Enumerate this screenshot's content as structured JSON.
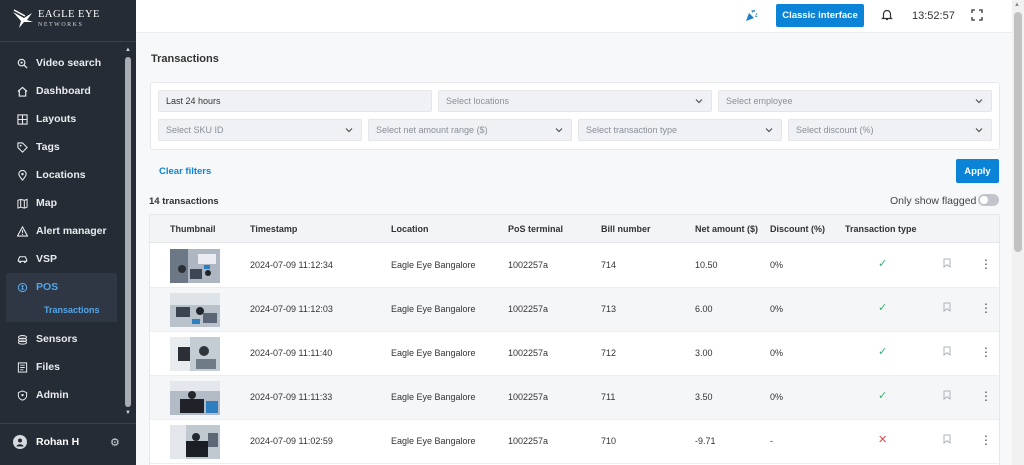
{
  "brand": {
    "name_line1": "EAGLE EYE",
    "name_line2": "NETWORKS"
  },
  "sidebar": {
    "items": [
      {
        "label": "Video search",
        "icon": "video-search-icon"
      },
      {
        "label": "Dashboard",
        "icon": "home-icon"
      },
      {
        "label": "Layouts",
        "icon": "layouts-icon"
      },
      {
        "label": "Tags",
        "icon": "tag-icon"
      },
      {
        "label": "Locations",
        "icon": "location-pin-icon"
      },
      {
        "label": "Map",
        "icon": "map-icon"
      },
      {
        "label": "Alert manager",
        "icon": "alert-icon"
      },
      {
        "label": "VSP",
        "icon": "car-icon"
      },
      {
        "label": "POS",
        "icon": "pos-icon"
      },
      {
        "label": "Sensors",
        "icon": "sensors-icon"
      },
      {
        "label": "Files",
        "icon": "files-icon"
      },
      {
        "label": "Admin",
        "icon": "admin-icon"
      }
    ],
    "active_sub": "Transactions",
    "user": "Rohan H"
  },
  "topbar": {
    "classic_button": "Classic interface",
    "time": "13:52:57"
  },
  "page": {
    "title": "Transactions",
    "filters": {
      "time_range": "Last 24 hours",
      "locations": "Select locations",
      "employee": "Select employee",
      "sku": "Select SKU ID",
      "net_amount": "Select net amount range ($)",
      "transaction_type": "Select transaction type",
      "discount": "Select discount (%)"
    },
    "clear_filters": "Clear filters",
    "apply": "Apply",
    "count": "14 transactions",
    "only_flagged": "Only show flagged"
  },
  "table": {
    "columns": [
      "Thumbnail",
      "Timestamp",
      "Location",
      "PoS terminal",
      "Bill number",
      "Net amount ($)",
      "Discount (%)",
      "Transaction type"
    ],
    "rows": [
      {
        "timestamp": "2024-07-09 11:12:34",
        "location": "Eagle Eye Bangalore",
        "terminal": "1002257a",
        "bill": "714",
        "amount": "10.50",
        "discount": "0%",
        "status": "success"
      },
      {
        "timestamp": "2024-07-09 11:12:03",
        "location": "Eagle Eye Bangalore",
        "terminal": "1002257a",
        "bill": "713",
        "amount": "6.00",
        "discount": "0%",
        "status": "success"
      },
      {
        "timestamp": "2024-07-09 11:11:40",
        "location": "Eagle Eye Bangalore",
        "terminal": "1002257a",
        "bill": "712",
        "amount": "3.00",
        "discount": "0%",
        "status": "success"
      },
      {
        "timestamp": "2024-07-09 11:11:33",
        "location": "Eagle Eye Bangalore",
        "terminal": "1002257a",
        "bill": "711",
        "amount": "3.50",
        "discount": "0%",
        "status": "success"
      },
      {
        "timestamp": "2024-07-09 11:02:59",
        "location": "Eagle Eye Bangalore",
        "terminal": "1002257a",
        "bill": "710",
        "amount": "-9.71",
        "discount": "-",
        "status": "failed"
      }
    ]
  },
  "colors": {
    "accent": "#0b84d8",
    "success": "#2fb36b",
    "failed": "#e04b4b",
    "sidebar": "#262c36"
  }
}
